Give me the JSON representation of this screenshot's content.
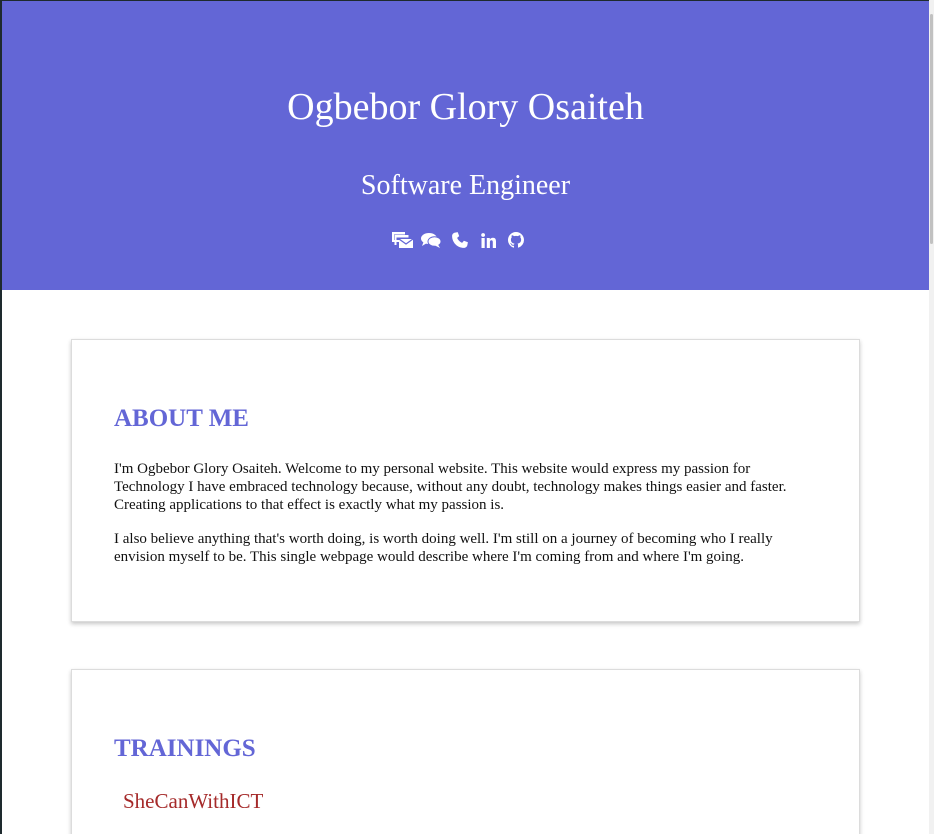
{
  "hero": {
    "name": "Ogbebor Glory Osaiteh",
    "title": "Software Engineer",
    "socials": [
      {
        "icon": "mail-bulk-icon"
      },
      {
        "icon": "comments-icon"
      },
      {
        "icon": "phone-icon"
      },
      {
        "icon": "linkedin-icon"
      },
      {
        "icon": "github-icon"
      }
    ]
  },
  "about": {
    "heading": "ABOUT ME",
    "paragraphs": [
      "I'm Ogbebor Glory Osaiteh. Welcome to my personal website. This website would express my passion for Technology I have embraced technology because, without any doubt, technology makes things easier and faster. Creating applications to that effect is exactly what my passion is.",
      "I also believe anything that's worth doing, is worth doing well. I'm still on a journey of becoming who I really envision myself to be. This single webpage would describe where I'm coming from and where I'm going."
    ]
  },
  "trainings": {
    "heading": "TRAININGS",
    "items": [
      "SheCanWithICT"
    ]
  },
  "colors": {
    "accent": "#6366d6",
    "training_link": "#a52a2a",
    "background": "#ffffff",
    "hero_text": "#ffffff"
  }
}
